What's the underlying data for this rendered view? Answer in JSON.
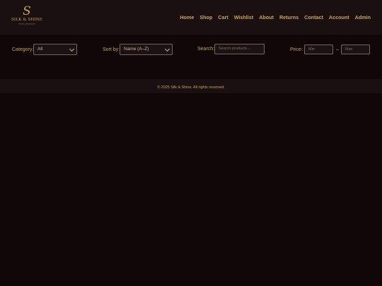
{
  "brand": {
    "mark": "S",
    "name": "SILK & SHINE",
    "tagline": "FINE JEWELRY"
  },
  "nav": {
    "items": [
      {
        "label": "Home"
      },
      {
        "label": "Shop"
      },
      {
        "label": "Cart"
      },
      {
        "label": "Wishlist"
      },
      {
        "label": "About"
      },
      {
        "label": "Returns"
      },
      {
        "label": "Contact"
      },
      {
        "label": "Account"
      },
      {
        "label": "Admin"
      }
    ]
  },
  "filters": {
    "category_label": "Category:",
    "category_value": "All",
    "sort_label": "Sort by:",
    "sort_value": "Name (A–Z)",
    "search_label": "Search:",
    "search_placeholder": "Search products...",
    "price_label": "Price:",
    "price_min_placeholder": "Min",
    "price_separator": "–",
    "price_max_placeholder": "Max"
  },
  "footer": {
    "text": "© 2025 Silk & Shine. All rights reserved."
  },
  "colors": {
    "background": "#0f0708",
    "header": "#1a1011",
    "accent": "#c9a25a"
  }
}
